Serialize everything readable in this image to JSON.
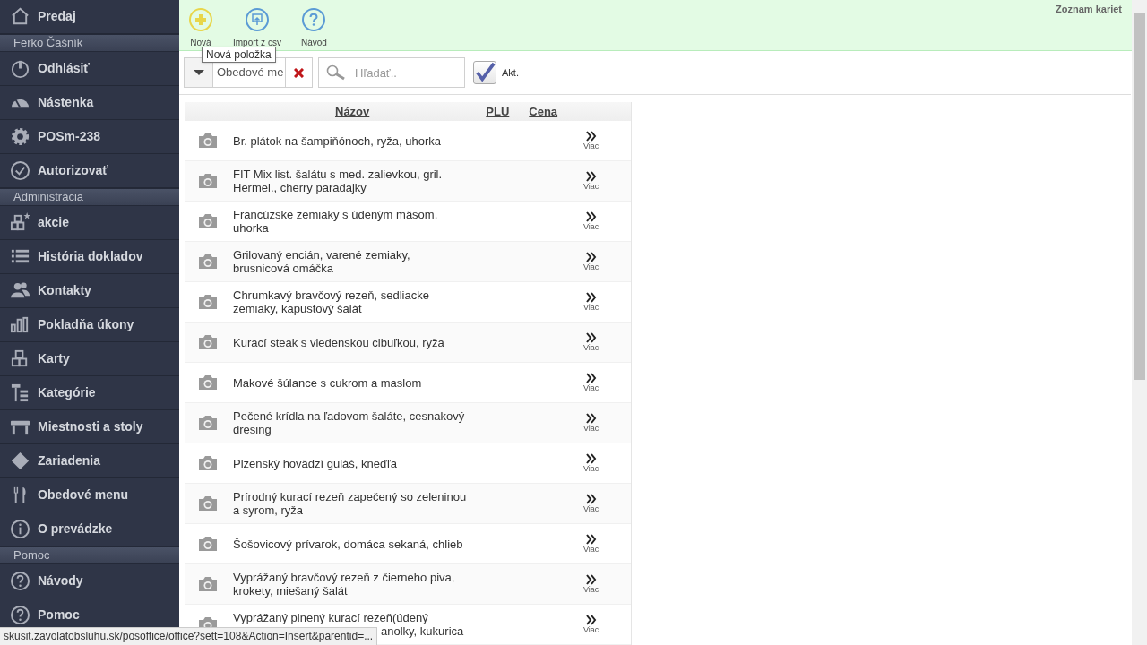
{
  "sidebar": {
    "items": [
      {
        "kind": "item",
        "label": "Predaj"
      },
      {
        "kind": "header",
        "label": "Ferko Čašník"
      },
      {
        "kind": "item",
        "label": "Odhlásiť"
      },
      {
        "kind": "item",
        "label": "Nástenka"
      },
      {
        "kind": "item",
        "label": "POSm-238"
      },
      {
        "kind": "item",
        "label": "Autorizovať"
      },
      {
        "kind": "header",
        "label": "Administrácia"
      },
      {
        "kind": "item",
        "label": "akcie"
      },
      {
        "kind": "item",
        "label": "História dokladov"
      },
      {
        "kind": "item",
        "label": "Kontakty"
      },
      {
        "kind": "item",
        "label": "Pokladňa úkony"
      },
      {
        "kind": "item",
        "label": "Karty"
      },
      {
        "kind": "item",
        "label": "Kategórie"
      },
      {
        "kind": "item",
        "label": "Miestnosti a stoly"
      },
      {
        "kind": "item",
        "label": "Zariadenia"
      },
      {
        "kind": "item",
        "label": "Obedové menu"
      },
      {
        "kind": "item",
        "label": "O prevádzke"
      },
      {
        "kind": "header",
        "label": "Pomoc"
      },
      {
        "kind": "item",
        "label": "Návody"
      },
      {
        "kind": "item",
        "label": "Pomoc"
      }
    ]
  },
  "toolbar": {
    "buttons": [
      {
        "label": "Nová",
        "color": "#e8d64a"
      },
      {
        "label": "Import z csv",
        "color": "#5b9bd5"
      },
      {
        "label": "Návod",
        "color": "#5b9bd5"
      }
    ],
    "tooltip": "Nová položka",
    "top_right": "Zoznam kariet"
  },
  "filter": {
    "category": "Obedové me",
    "search_placeholder": "Hľadať..",
    "active_checked": true,
    "active_label": "Akt."
  },
  "table": {
    "columns": [
      "Názov",
      "PLU",
      "Cena"
    ],
    "rows": [
      {
        "name": [
          "Br. plátok na šampiňónoch, ryža, uhorka"
        ],
        "more": "Viac"
      },
      {
        "name": [
          "FIT Mix list. šalátu s med. zalievkou, gril.",
          "Hermel., cherry paradajky"
        ],
        "more": "Viac"
      },
      {
        "name": [
          "Francúzske zemiaky s údeným mäsom,",
          "uhorka"
        ],
        "more": "Viac"
      },
      {
        "name": [
          "Grilovaný encián, varené zemiaky,",
          "brusnicová omáčka"
        ],
        "more": "Viac"
      },
      {
        "name": [
          "Chrumkavý bravčový rezeň, sedliacke",
          "zemiaky, kapustový šalát"
        ],
        "more": "Viac"
      },
      {
        "name": [
          "Kurací steak s viedenskou cibuľkou, ryža"
        ],
        "more": "Viac"
      },
      {
        "name": [
          "Makové šúlance s cukrom a maslom"
        ],
        "more": "Viac"
      },
      {
        "name": [
          "Pečené krídla na ľadovom šaláte, cesnakový",
          "dresing"
        ],
        "more": "Viac"
      },
      {
        "name": [
          "Plzenský hovädzí guláš, kneďľa"
        ],
        "more": "Viac"
      },
      {
        "name": [
          "Prírodný kurací rezeň zapečený so zeleninou",
          "a syrom, ryža"
        ],
        "more": "Viac"
      },
      {
        "name": [
          "Šošovicový prívarok, domáca sekaná, chlieb"
        ],
        "more": "Viac"
      },
      {
        "name": [
          "Vyprážaný bravčový rezeň z čierneho piva,",
          "krokety, miešaný šalát"
        ],
        "more": "Viac"
      },
      {
        "name": [
          "Vyprážaný plnený kurací rezeň(údený"
        ],
        "name_tail": "anolky, kukurica",
        "more": "Viac"
      }
    ]
  },
  "status_url": "skusit.zavolatobsluhu.sk/posoffice/office?sett=108&Action=Insert&parentid=..."
}
